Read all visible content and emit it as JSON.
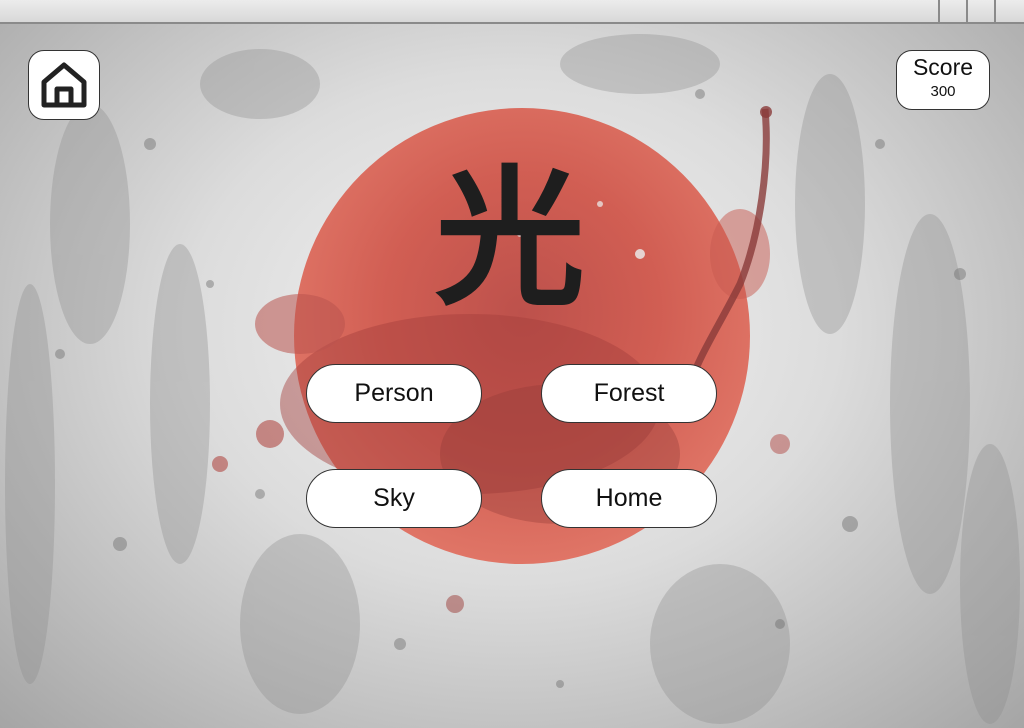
{
  "header": {
    "home_icon": "home-icon"
  },
  "score": {
    "label": "Score",
    "value": "300"
  },
  "question": {
    "kanji": "光"
  },
  "answers": [
    {
      "label": "Person"
    },
    {
      "label": "Forest"
    },
    {
      "label": "Sky"
    },
    {
      "label": "Home"
    }
  ],
  "colors": {
    "sun_red": "#d9574a",
    "sun_dark": "#9e3a36",
    "background_gray": "#cfcfcf",
    "text_dark": "#1e1e1e"
  }
}
